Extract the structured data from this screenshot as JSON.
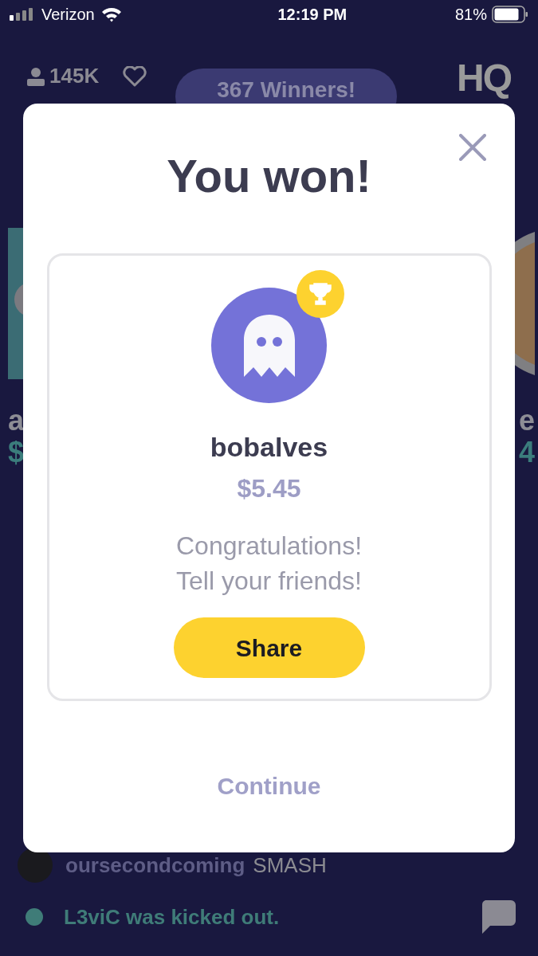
{
  "status_bar": {
    "carrier": "Verizon",
    "time": "12:19 PM",
    "battery": "81%"
  },
  "header": {
    "viewers": "145K",
    "winners": "367 Winners!",
    "logo": "HQ"
  },
  "background_winners": [
    {
      "name": "a",
      "prize": "$"
    },
    {
      "name": "e",
      "prize": "4"
    }
  ],
  "chat": [
    {
      "kind": "message",
      "user": "oursecondcoming",
      "message": "SMASH"
    },
    {
      "kind": "event",
      "text": "L3viC was kicked out."
    }
  ],
  "modal": {
    "title": "You won!",
    "winner": {
      "username": "bobalves",
      "prize": "$5.45"
    },
    "message_lines": [
      "Congratulations!",
      "Tell your friends!"
    ],
    "share_button": "Share",
    "continue_button": "Continue"
  }
}
